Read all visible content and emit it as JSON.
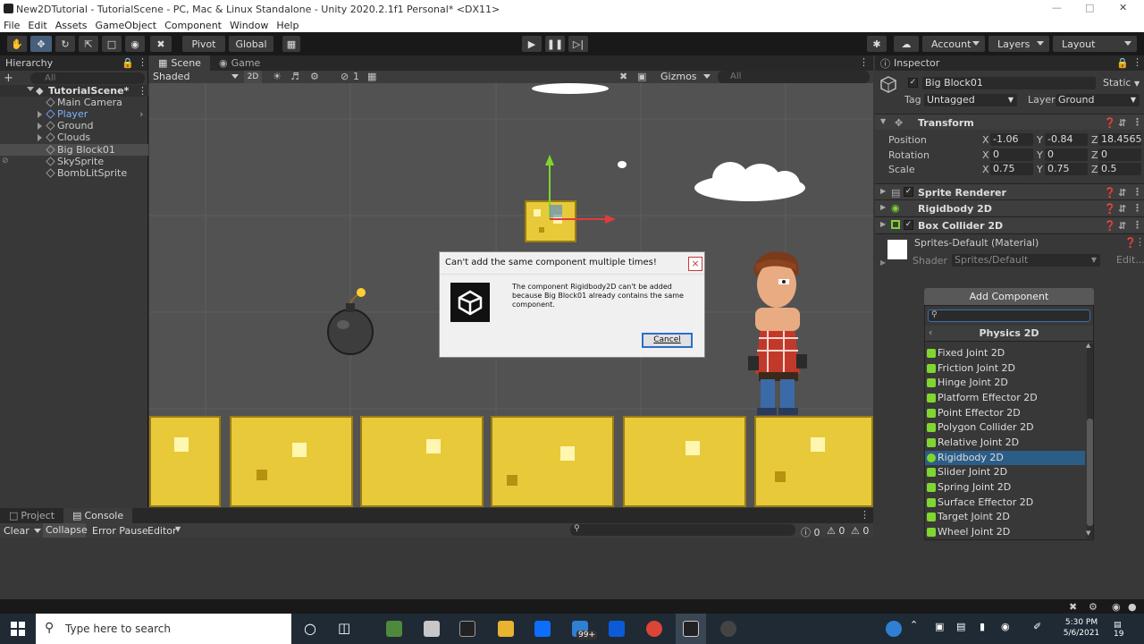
{
  "window": {
    "title": "New2DTutorial - TutorialScene - PC, Mac & Linux Standalone - Unity 2020.2.1f1 Personal* <DX11>"
  },
  "menu": [
    "File",
    "Edit",
    "Assets",
    "GameObject",
    "Component",
    "Window",
    "Help"
  ],
  "toolbar": {
    "pivot": "Pivot",
    "global": "Global",
    "account": "Account",
    "layers": "Layers",
    "layout": "Layout"
  },
  "hierarchy": {
    "tab": "Hierarchy",
    "search_placeholder": "All",
    "scene": "TutorialScene*",
    "items": [
      "Main Camera",
      "Player",
      "Ground",
      "Clouds",
      "Big Block01",
      "SkySprite",
      "BombLitSprite"
    ]
  },
  "scene": {
    "tabs": [
      "Scene",
      "Game"
    ],
    "shading": "Shaded",
    "mode_2d": "2D",
    "hidden_count": "1",
    "gizmos": "Gizmos",
    "search_placeholder": "All"
  },
  "dialog": {
    "title": "Can't add the same component multiple times!",
    "message": "The component Rigidbody2D can't be added because Big Block01  already contains the same component.",
    "cancel": "Cancel",
    "close": "×"
  },
  "inspector": {
    "tab": "Inspector",
    "object_name": "Big Block01",
    "static": "Static",
    "tag_label": "Tag",
    "tag": "Untagged",
    "layer_label": "Layer",
    "layer": "Ground",
    "transform": {
      "title": "Transform",
      "position_label": "Position",
      "rotation_label": "Rotation",
      "scale_label": "Scale",
      "axis_x": "X",
      "axis_y": "Y",
      "axis_z": "Z",
      "position": [
        "-1.06",
        "-0.84",
        "18.45655"
      ],
      "rotation": [
        "0",
        "0",
        "0"
      ],
      "scale": [
        "0.75",
        "0.75",
        "0.5"
      ]
    },
    "components": [
      "Sprite Renderer",
      "Rigidbody 2D",
      "Box Collider 2D"
    ],
    "material": "Sprites-Default (Material)",
    "shader_label": "Shader",
    "shader": "Sprites/Default",
    "edit": "Edit...",
    "add_component": "Add Component",
    "category": "Physics 2D",
    "list": [
      "Fixed Joint 2D",
      "Friction Joint 2D",
      "Hinge Joint 2D",
      "Platform Effector 2D",
      "Point Effector 2D",
      "Polygon Collider 2D",
      "Relative Joint 2D",
      "Rigidbody 2D",
      "Slider Joint 2D",
      "Spring Joint 2D",
      "Surface Effector 2D",
      "Target Joint 2D",
      "Wheel Joint 2D"
    ],
    "selected": "Rigidbody 2D"
  },
  "console": {
    "tabs": [
      "Project",
      "Console"
    ],
    "clear": "Clear",
    "collapse": "Collapse",
    "error_pause": "Error Pause",
    "editor": "Editor",
    "counts": [
      "0",
      "0",
      "0"
    ]
  },
  "taskbar": {
    "search_placeholder": "Type here to search",
    "badge": "99+",
    "time": "5:30 PM",
    "date": "5/6/2021",
    "notifications": "19"
  },
  "colors": {
    "selection": "#2c5d87",
    "accent_blue": "#46607c",
    "block_yellow": "#e8c93a"
  }
}
